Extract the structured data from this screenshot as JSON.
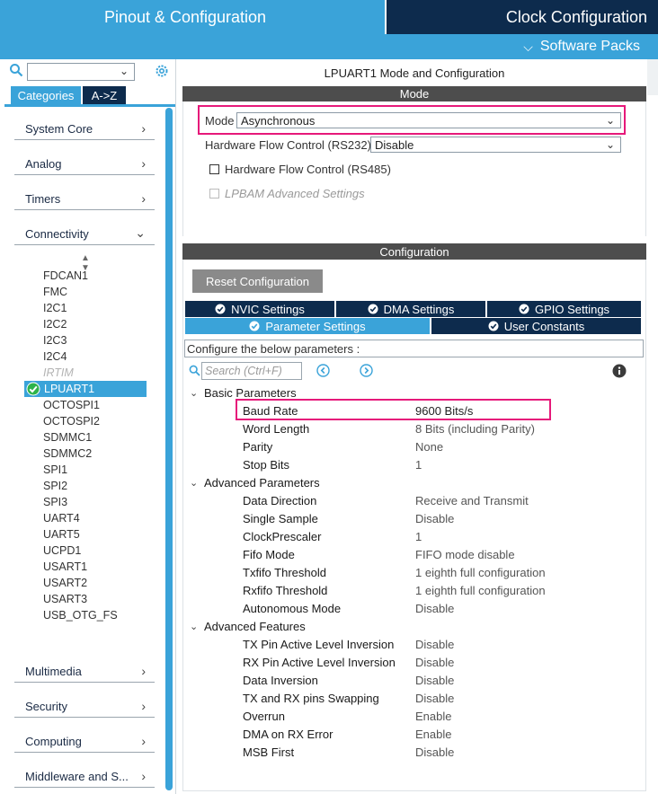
{
  "header": {
    "left_title": "Pinout & Configuration",
    "right_title": "Clock Configuration",
    "software_packs": "Software Packs"
  },
  "sidebar": {
    "tabs": [
      "Categories",
      "A->Z"
    ],
    "categories_top": [
      {
        "label": "System Core",
        "state": "collapsed"
      },
      {
        "label": "Analog",
        "state": "collapsed"
      },
      {
        "label": "Timers",
        "state": "collapsed"
      },
      {
        "label": "Connectivity",
        "state": "expanded"
      }
    ],
    "connectivity_items": [
      "FDCAN1",
      "FMC",
      "I2C1",
      "I2C2",
      "I2C3",
      "I2C4",
      "IRTIM",
      "LPUART1",
      "OCTOSPI1",
      "OCTOSPI2",
      "SDMMC1",
      "SDMMC2",
      "SPI1",
      "SPI2",
      "SPI3",
      "UART4",
      "UART5",
      "UCPD1",
      "USART1",
      "USART2",
      "USART3",
      "USB_OTG_FS"
    ],
    "disabled_item": "IRTIM",
    "selected_item": "LPUART1",
    "categories_bottom": [
      {
        "label": "Multimedia"
      },
      {
        "label": "Security"
      },
      {
        "label": "Computing"
      },
      {
        "label": "Middleware and S..."
      }
    ]
  },
  "panel": {
    "title": "LPUART1 Mode and Configuration",
    "mode_header": "Mode",
    "mode_label": "Mode",
    "mode_value": "Asynchronous",
    "hfc_label": "Hardware Flow Control (RS232)",
    "hfc_value": "Disable",
    "rs485_label": "Hardware Flow Control (RS485)",
    "lpbam_label": "LPBAM Advanced Settings",
    "config_header": "Configuration",
    "reset_button": "Reset Configuration",
    "tabs": {
      "nvic": "NVIC Settings",
      "dma": "DMA Settings",
      "gpio": "GPIO Settings",
      "param": "Parameter Settings",
      "userc": "User Constants"
    },
    "hint": "Configure the below parameters :",
    "search_placeholder": "Search (Ctrl+F)",
    "groups": [
      {
        "name": "Basic Parameters",
        "params": [
          {
            "name": "Baud Rate",
            "value": "9600 Bits/s"
          },
          {
            "name": "Word Length",
            "value": "8 Bits (including Parity)"
          },
          {
            "name": "Parity",
            "value": "None"
          },
          {
            "name": "Stop Bits",
            "value": "1"
          }
        ]
      },
      {
        "name": "Advanced Parameters",
        "params": [
          {
            "name": "Data Direction",
            "value": "Receive and Transmit"
          },
          {
            "name": "Single Sample",
            "value": "Disable"
          },
          {
            "name": "ClockPrescaler",
            "value": "1"
          },
          {
            "name": "Fifo Mode",
            "value": "FIFO mode disable"
          },
          {
            "name": "Txfifo Threshold",
            "value": "1 eighth full configuration"
          },
          {
            "name": "Rxfifo Threshold",
            "value": "1 eighth full configuration"
          },
          {
            "name": "Autonomous Mode",
            "value": "Disable"
          }
        ]
      },
      {
        "name": "Advanced Features",
        "params": [
          {
            "name": "TX Pin Active Level Inversion",
            "value": "Disable"
          },
          {
            "name": "RX Pin Active Level Inversion",
            "value": "Disable"
          },
          {
            "name": "Data Inversion",
            "value": "Disable"
          },
          {
            "name": "TX and RX pins Swapping",
            "value": "Disable"
          },
          {
            "name": "Overrun",
            "value": "Enable"
          },
          {
            "name": "DMA on RX Error",
            "value": "Enable"
          },
          {
            "name": "MSB First",
            "value": "Disable"
          }
        ]
      }
    ]
  },
  "colors": {
    "accent": "#3aa3d9",
    "dark": "#0d2b4d",
    "highlight": "#e6197a",
    "ok_green": "#2db34a"
  }
}
